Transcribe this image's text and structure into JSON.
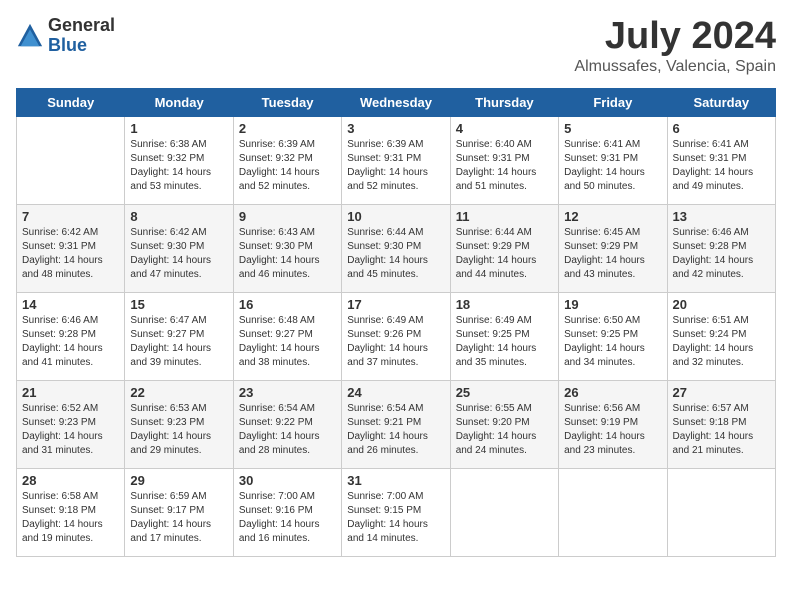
{
  "header": {
    "logo_general": "General",
    "logo_blue": "Blue",
    "month_year": "July 2024",
    "location": "Almussafes, Valencia, Spain"
  },
  "weekdays": [
    "Sunday",
    "Monday",
    "Tuesday",
    "Wednesday",
    "Thursday",
    "Friday",
    "Saturday"
  ],
  "weeks": [
    [
      {
        "day": "",
        "text": ""
      },
      {
        "day": "1",
        "text": "Sunrise: 6:38 AM\nSunset: 9:32 PM\nDaylight: 14 hours\nand 53 minutes."
      },
      {
        "day": "2",
        "text": "Sunrise: 6:39 AM\nSunset: 9:32 PM\nDaylight: 14 hours\nand 52 minutes."
      },
      {
        "day": "3",
        "text": "Sunrise: 6:39 AM\nSunset: 9:31 PM\nDaylight: 14 hours\nand 52 minutes."
      },
      {
        "day": "4",
        "text": "Sunrise: 6:40 AM\nSunset: 9:31 PM\nDaylight: 14 hours\nand 51 minutes."
      },
      {
        "day": "5",
        "text": "Sunrise: 6:41 AM\nSunset: 9:31 PM\nDaylight: 14 hours\nand 50 minutes."
      },
      {
        "day": "6",
        "text": "Sunrise: 6:41 AM\nSunset: 9:31 PM\nDaylight: 14 hours\nand 49 minutes."
      }
    ],
    [
      {
        "day": "7",
        "text": "Sunrise: 6:42 AM\nSunset: 9:31 PM\nDaylight: 14 hours\nand 48 minutes."
      },
      {
        "day": "8",
        "text": "Sunrise: 6:42 AM\nSunset: 9:30 PM\nDaylight: 14 hours\nand 47 minutes."
      },
      {
        "day": "9",
        "text": "Sunrise: 6:43 AM\nSunset: 9:30 PM\nDaylight: 14 hours\nand 46 minutes."
      },
      {
        "day": "10",
        "text": "Sunrise: 6:44 AM\nSunset: 9:30 PM\nDaylight: 14 hours\nand 45 minutes."
      },
      {
        "day": "11",
        "text": "Sunrise: 6:44 AM\nSunset: 9:29 PM\nDaylight: 14 hours\nand 44 minutes."
      },
      {
        "day": "12",
        "text": "Sunrise: 6:45 AM\nSunset: 9:29 PM\nDaylight: 14 hours\nand 43 minutes."
      },
      {
        "day": "13",
        "text": "Sunrise: 6:46 AM\nSunset: 9:28 PM\nDaylight: 14 hours\nand 42 minutes."
      }
    ],
    [
      {
        "day": "14",
        "text": "Sunrise: 6:46 AM\nSunset: 9:28 PM\nDaylight: 14 hours\nand 41 minutes."
      },
      {
        "day": "15",
        "text": "Sunrise: 6:47 AM\nSunset: 9:27 PM\nDaylight: 14 hours\nand 39 minutes."
      },
      {
        "day": "16",
        "text": "Sunrise: 6:48 AM\nSunset: 9:27 PM\nDaylight: 14 hours\nand 38 minutes."
      },
      {
        "day": "17",
        "text": "Sunrise: 6:49 AM\nSunset: 9:26 PM\nDaylight: 14 hours\nand 37 minutes."
      },
      {
        "day": "18",
        "text": "Sunrise: 6:49 AM\nSunset: 9:25 PM\nDaylight: 14 hours\nand 35 minutes."
      },
      {
        "day": "19",
        "text": "Sunrise: 6:50 AM\nSunset: 9:25 PM\nDaylight: 14 hours\nand 34 minutes."
      },
      {
        "day": "20",
        "text": "Sunrise: 6:51 AM\nSunset: 9:24 PM\nDaylight: 14 hours\nand 32 minutes."
      }
    ],
    [
      {
        "day": "21",
        "text": "Sunrise: 6:52 AM\nSunset: 9:23 PM\nDaylight: 14 hours\nand 31 minutes."
      },
      {
        "day": "22",
        "text": "Sunrise: 6:53 AM\nSunset: 9:23 PM\nDaylight: 14 hours\nand 29 minutes."
      },
      {
        "day": "23",
        "text": "Sunrise: 6:54 AM\nSunset: 9:22 PM\nDaylight: 14 hours\nand 28 minutes."
      },
      {
        "day": "24",
        "text": "Sunrise: 6:54 AM\nSunset: 9:21 PM\nDaylight: 14 hours\nand 26 minutes."
      },
      {
        "day": "25",
        "text": "Sunrise: 6:55 AM\nSunset: 9:20 PM\nDaylight: 14 hours\nand 24 minutes."
      },
      {
        "day": "26",
        "text": "Sunrise: 6:56 AM\nSunset: 9:19 PM\nDaylight: 14 hours\nand 23 minutes."
      },
      {
        "day": "27",
        "text": "Sunrise: 6:57 AM\nSunset: 9:18 PM\nDaylight: 14 hours\nand 21 minutes."
      }
    ],
    [
      {
        "day": "28",
        "text": "Sunrise: 6:58 AM\nSunset: 9:18 PM\nDaylight: 14 hours\nand 19 minutes."
      },
      {
        "day": "29",
        "text": "Sunrise: 6:59 AM\nSunset: 9:17 PM\nDaylight: 14 hours\nand 17 minutes."
      },
      {
        "day": "30",
        "text": "Sunrise: 7:00 AM\nSunset: 9:16 PM\nDaylight: 14 hours\nand 16 minutes."
      },
      {
        "day": "31",
        "text": "Sunrise: 7:00 AM\nSunset: 9:15 PM\nDaylight: 14 hours\nand 14 minutes."
      },
      {
        "day": "",
        "text": ""
      },
      {
        "day": "",
        "text": ""
      },
      {
        "day": "",
        "text": ""
      }
    ]
  ]
}
